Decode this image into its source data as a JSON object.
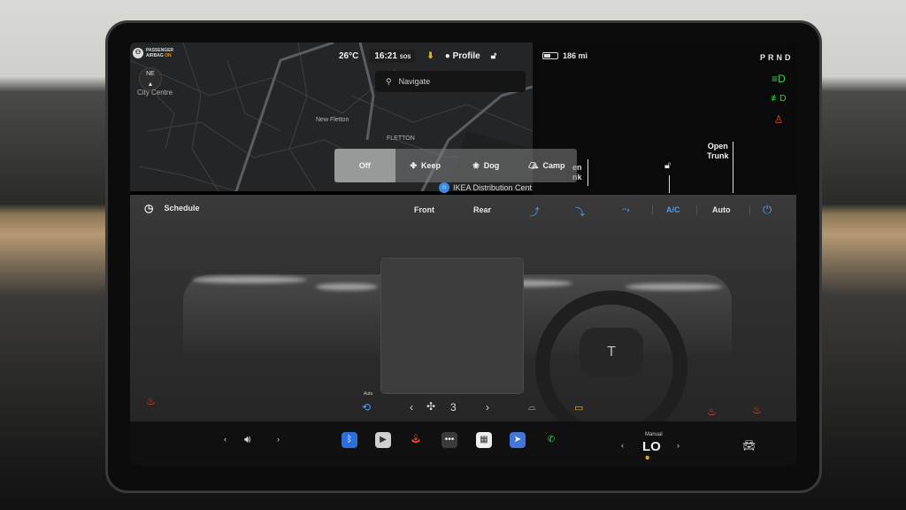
{
  "airbag": {
    "line1": "PASSENGER",
    "line2": "AIRBAG",
    "state": "ON"
  },
  "compass": {
    "heading": "NE",
    "arrow": "▲"
  },
  "map": {
    "labels": {
      "city_centre": "City Centre",
      "new_fletton": "New Fletton",
      "fletton": "FLETTON"
    },
    "poi": "IKEA Distribution Cent"
  },
  "status": {
    "temperature": "26°C",
    "time": "16:21",
    "sos": "SOS",
    "profile": "Profile"
  },
  "battery": {
    "range": "186 mi",
    "level_percent": 45
  },
  "gear": "PRND",
  "search": {
    "placeholder": "Navigate"
  },
  "trunk": {
    "front_partial": "en\nnk",
    "rear": "Open\nTrunk"
  },
  "modes": [
    {
      "label": "Off",
      "icon": "",
      "active": true
    },
    {
      "label": "Keep",
      "icon": "fan-icon",
      "active": false
    },
    {
      "label": "Dog",
      "icon": "paw-icon",
      "active": false
    },
    {
      "label": "Camp",
      "icon": "tent-icon",
      "active": false
    }
  ],
  "climate": {
    "schedule": "Schedule",
    "front": "Front",
    "rear": "Rear",
    "ac": "A/C",
    "auto": "Auto",
    "recirc_label": "Auto",
    "fan_speed": "3"
  },
  "dock": {
    "cabin_mode": "Manual",
    "temp": "LO"
  },
  "colors": {
    "accent_blue": "#4f9cf0",
    "heat_red": "#ef4a3a",
    "amber": "#f2b01e",
    "lights_green": "#3ad35a"
  }
}
